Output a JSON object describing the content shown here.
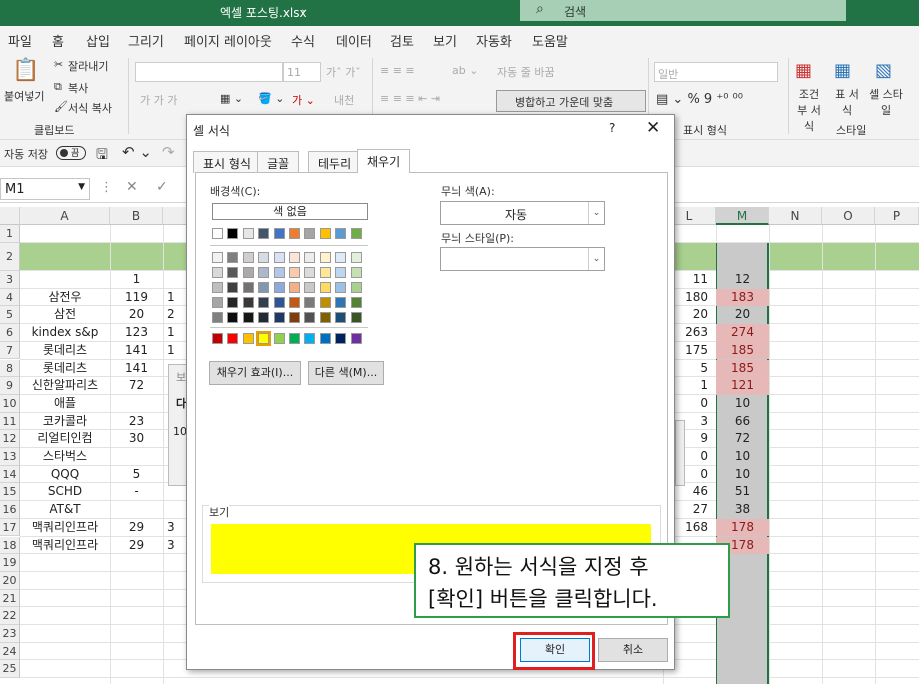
{
  "title": "엑셀 포스팅.xlsx",
  "search_label": "검색",
  "menu": [
    "파일",
    "홈",
    "삽입",
    "그리기",
    "페이지 레이아웃",
    "수식",
    "데이터",
    "검토",
    "보기",
    "자동화",
    "도움말"
  ],
  "ribbon": {
    "paste": "붙여넣기",
    "cut": "잘라내기",
    "copy": "복사",
    "format_painter": "서식 복사",
    "clipboard": "클립보드",
    "font_size": "11",
    "wrap_text": "자동 줄 바꿈",
    "merge_center": "병합하고 가운데 맞춤",
    "number_format": "일반",
    "number_group": "표시 형식",
    "cond_format": "조건부 서식",
    "table_format": "표 서식",
    "cell_styles": "셀 스타일",
    "styles_group": "스타일"
  },
  "autosave": "자동 저장",
  "autosave_toggle": "끔",
  "namebox": "M1",
  "columns": [
    "A",
    "B",
    "L",
    "M",
    "N",
    "O",
    "P"
  ],
  "rows": [
    "1",
    "2",
    "3",
    "4",
    "5",
    "6",
    "7",
    "8",
    "9",
    "10",
    "11",
    "12",
    "13",
    "14",
    "15",
    "16",
    "17",
    "18",
    "19",
    "20",
    "21",
    "22",
    "23",
    "24",
    "25"
  ],
  "col_a": [
    "",
    "",
    "",
    "삼전우",
    "삼전",
    "kindex s&p",
    "롯데리츠",
    "롯데리츠",
    "신한알파리츠",
    "애플",
    "코카콜라",
    "리얼티인컴",
    "스타벅스",
    "QQQ",
    "SCHD",
    "AT&T",
    "맥쿼리인프라",
    "맥쿼리인프라"
  ],
  "col_b": [
    "",
    "",
    "1",
    "119",
    "20",
    "123",
    "141",
    "141",
    "72",
    "",
    "23",
    "30",
    "",
    "5",
    "-",
    "",
    "29",
    "29"
  ],
  "col_c": [
    "",
    "",
    "",
    "1",
    "2",
    "1",
    "1",
    "",
    "",
    "",
    "",
    "",
    "",
    "",
    "",
    "",
    "3",
    "3"
  ],
  "col_l": [
    "",
    "",
    "11",
    "180",
    "20",
    "263",
    "175",
    "5",
    "1",
    "0",
    "3",
    "9",
    "0",
    "0",
    "46",
    "27",
    "168",
    ""
  ],
  "col_m": [
    "",
    "",
    "12",
    "183",
    "20",
    "274",
    "185",
    "185",
    "121",
    "10",
    "66",
    "72",
    "10",
    "10",
    "51",
    "38",
    "178",
    "178"
  ],
  "bg_row_partial": {
    "e": "보",
    "d": "다",
    "f": "10"
  },
  "dialog": {
    "title": "셀 서식",
    "help": "?",
    "close": "✕",
    "tabs": [
      "표시 형식",
      "글꼴",
      "테두리",
      "채우기"
    ],
    "bg_color_label": "배경색(C):",
    "no_color": "색 없음",
    "fill_effects": "채우기 효과(I)...",
    "more_colors": "다른 색(M)...",
    "pattern_color_label": "무늬 색(A):",
    "pattern_color_value": "자동",
    "pattern_style_label": "무늬 스타일(P):",
    "preview_label": "보기",
    "preview_color": "#ffff00",
    "ok": "확인",
    "cancel": "취소"
  },
  "callout": {
    "line1": "8. 원하는 서식을 지정 후",
    "line2": "[확인] 버튼을 클릭합니다."
  },
  "colors": {
    "theme_row": [
      "#ffffff",
      "#000000",
      "#e7e6e6",
      "#44546a",
      "#4472c4",
      "#ed7d31",
      "#a5a5a5",
      "#ffc000",
      "#5b9bd5",
      "#70ad47"
    ],
    "shades": [
      [
        "#f2f2f2",
        "#7f7f7f",
        "#d0cece",
        "#d6dce4",
        "#d9e1f2",
        "#fce4d6",
        "#ededed",
        "#fff2cc",
        "#ddebf7",
        "#e2efda"
      ],
      [
        "#d9d9d9",
        "#595959",
        "#aeaaaa",
        "#adb9ca",
        "#b4c6e7",
        "#f8cbad",
        "#dbdbdb",
        "#ffe699",
        "#bdd7ee",
        "#c6e0b4"
      ],
      [
        "#bfbfbf",
        "#404040",
        "#757171",
        "#8497b0",
        "#8ea9db",
        "#f4b084",
        "#c9c9c9",
        "#ffd966",
        "#9bc2e6",
        "#a9d08e"
      ],
      [
        "#a6a6a6",
        "#262626",
        "#3a3838",
        "#333f4f",
        "#2f5597",
        "#c65911",
        "#7b7b7b",
        "#bf8f00",
        "#2e75b6",
        "#548235"
      ],
      [
        "#808080",
        "#0d0d0d",
        "#161616",
        "#222b35",
        "#1f3864",
        "#833c0c",
        "#525252",
        "#806000",
        "#1f4e78",
        "#375623"
      ]
    ],
    "standard": [
      "#c00000",
      "#ff0000",
      "#ffc000",
      "#ffff00",
      "#92d050",
      "#00b050",
      "#00b0f0",
      "#0070c0",
      "#002060",
      "#7030a0"
    ],
    "header_green": "#a9d08e",
    "highlight_pink": "#e6b8b7",
    "col_m_fill": "#c9c9c9"
  }
}
